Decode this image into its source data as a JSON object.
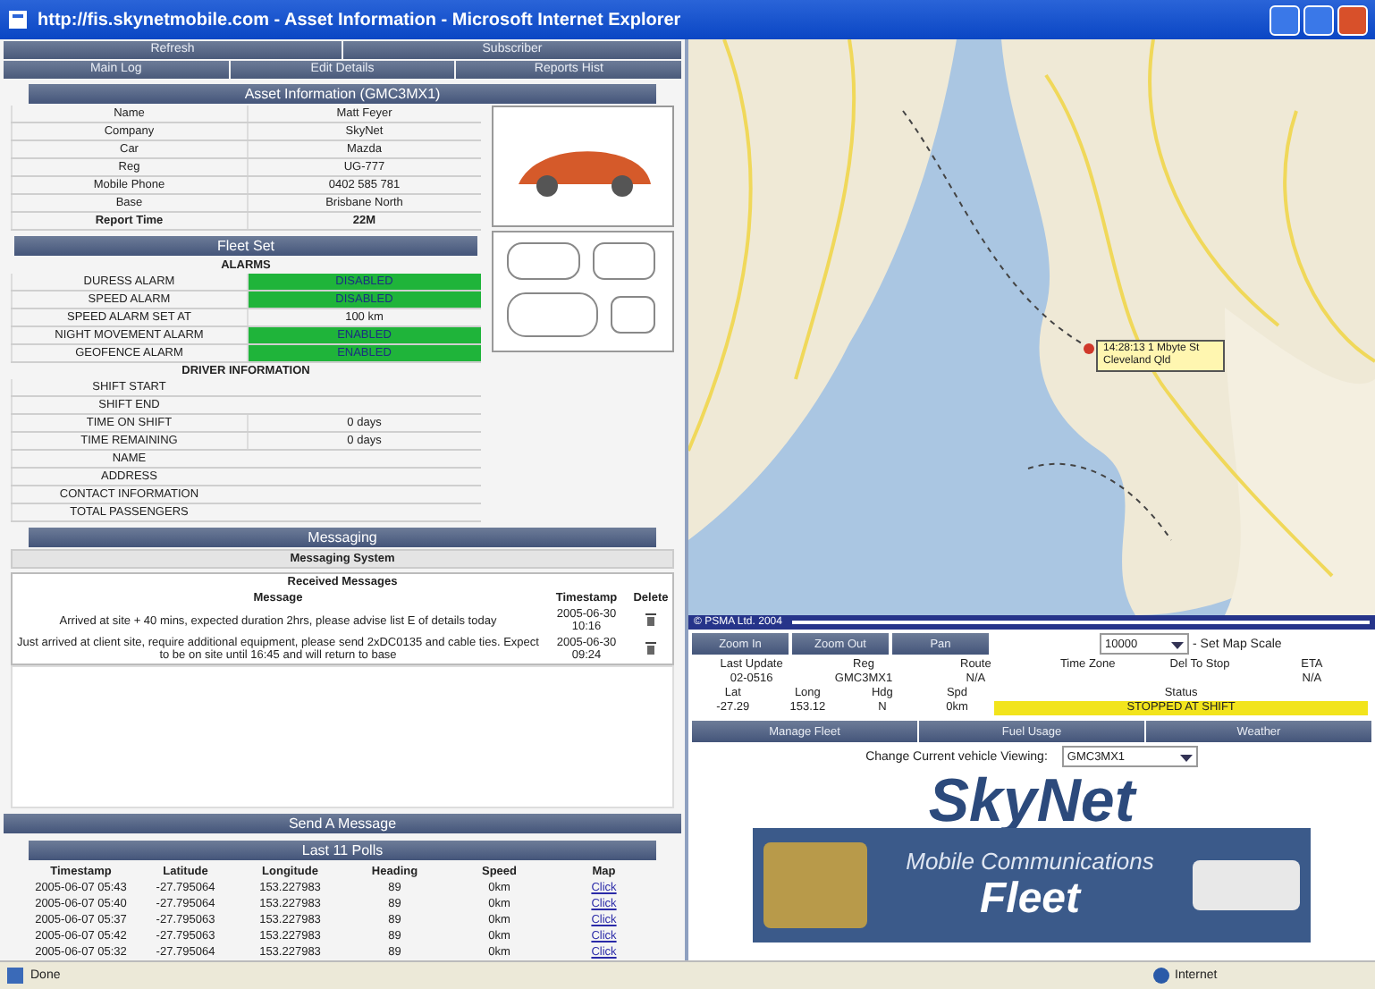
{
  "window": {
    "title": "http://fis.skynetmobile.com - Asset Information - Microsoft Internet Explorer"
  },
  "nav_rows": [
    [
      "Refresh",
      "Subscriber"
    ],
    [
      "Main Log",
      "Edit Details",
      "Reports Hist"
    ]
  ],
  "asset": {
    "title": "Asset Information (GMC3MX1)",
    "rows": [
      {
        "label": "Name",
        "value": "Matt Feyer",
        "bold": false
      },
      {
        "label": "Company",
        "value": "SkyNet",
        "bold": false
      },
      {
        "label": "Car",
        "value": "Mazda",
        "bold": false
      },
      {
        "label": "Reg",
        "value": "UG-777",
        "bold": false
      },
      {
        "label": "Mobile Phone",
        "value": "0402 585 781",
        "bold": false
      },
      {
        "label": "Base",
        "value": "Brisbane North",
        "bold": false
      },
      {
        "label": "Report Time",
        "value": "22M",
        "bold": true
      }
    ]
  },
  "fleet": {
    "title": "Fleet Set",
    "sections": [
      {
        "heading": "ALARMS",
        "rows": [
          {
            "label": "DURESS ALARM",
            "value": "DISABLED",
            "kind": "status"
          },
          {
            "label": "SPEED ALARM",
            "value": "DISABLED",
            "kind": "status"
          },
          {
            "label": "SPEED ALARM SET AT",
            "value": "100 km",
            "kind": "value"
          },
          {
            "label": "NIGHT MOVEMENT ALARM",
            "value": "ENABLED",
            "kind": "status"
          },
          {
            "label": "GEOFENCE ALARM",
            "value": "ENABLED",
            "kind": "status"
          }
        ]
      },
      {
        "heading": "DRIVER INFORMATION",
        "rows": [
          {
            "label": "SHIFT START"
          },
          {
            "label": "SHIFT END"
          },
          {
            "label": "TIME ON SHIFT",
            "value": "0 days"
          },
          {
            "label": "TIME REMAINING",
            "value": "0 days"
          },
          {
            "label": "NAME"
          },
          {
            "label": "ADDRESS"
          },
          {
            "label": "CONTACT INFORMATION"
          },
          {
            "label": "TOTAL PASSENGERS"
          }
        ]
      }
    ]
  },
  "messaging": {
    "title": "Messaging",
    "subtitle": "Messaging System",
    "table_title": "Received Messages",
    "columns": [
      "Message",
      "Timestamp",
      "Delete"
    ],
    "rows": [
      {
        "message": "Arrived at site + 40 mins, expected duration 2hrs, please advise list E of details today",
        "timestamp": "2005-06-30 10:16"
      },
      {
        "message": "Just arrived at client site, require additional equipment, please send 2xDC0135 and cable ties. Expect to be on site until 16:45 and will return to base",
        "timestamp": "2005-06-30 09:24"
      }
    ]
  },
  "send_message": {
    "label": "Send A Message"
  },
  "polls": {
    "title": "Last 11 Polls",
    "columns": [
      "Timestamp",
      "Latitude",
      "Longitude",
      "Heading",
      "Speed",
      "Map"
    ],
    "rows": [
      [
        "2005-06-07 05:43",
        "-27.795064",
        "153.227983",
        "89",
        "0km",
        "Click"
      ],
      [
        "2005-06-07 05:40",
        "-27.795064",
        "153.227983",
        "89",
        "0km",
        "Click"
      ],
      [
        "2005-06-07 05:37",
        "-27.795063",
        "153.227983",
        "89",
        "0km",
        "Click"
      ],
      [
        "2005-06-07 05:42",
        "-27.795063",
        "153.227983",
        "89",
        "0km",
        "Click"
      ],
      [
        "2005-06-07 05:32",
        "-27.795064",
        "153.227983",
        "89",
        "0km",
        "Click"
      ]
    ]
  },
  "map": {
    "marker_label": "14:28:13 1 Mbyte St Cleveland Qld",
    "copyright": "© PSMA Ltd. 2004"
  },
  "map_toolbar": {
    "buttons": [
      "Zoom In",
      "Zoom Out",
      "Pan"
    ],
    "scale": "10000",
    "scale_label": "- Set Map Scale"
  },
  "update_info": [
    {
      "label": "Last Update",
      "value": "02-0516"
    },
    {
      "label": "Reg",
      "value": "GMC3MX1"
    },
    {
      "label": "Route",
      "value": "N/A"
    },
    {
      "label": "Time Zone"
    },
    {
      "label": "Del To Stop"
    },
    {
      "label": "ETA",
      "value": "N/A"
    }
  ],
  "position_info": [
    {
      "label": "Lat",
      "value": "-27.29"
    },
    {
      "label": "Long",
      "value": "153.12"
    },
    {
      "label": "Hdg",
      "value": "N"
    },
    {
      "label": "Spd",
      "value": "0km"
    },
    {
      "label": "Status",
      "value": "STOPPED AT SHIFT",
      "kind": "status"
    }
  ],
  "tabs": [
    "Manage Fleet",
    "Fuel Usage",
    "Weather"
  ],
  "vehicle_select": {
    "label": "Change Current vehicle Viewing:",
    "value": "GMC3MX1"
  },
  "logo": {
    "name": "SkyNet",
    "tagline": "Mobile Communications",
    "product": "Fleet"
  },
  "status_bar": {
    "left": "Done",
    "right": "Internet"
  }
}
